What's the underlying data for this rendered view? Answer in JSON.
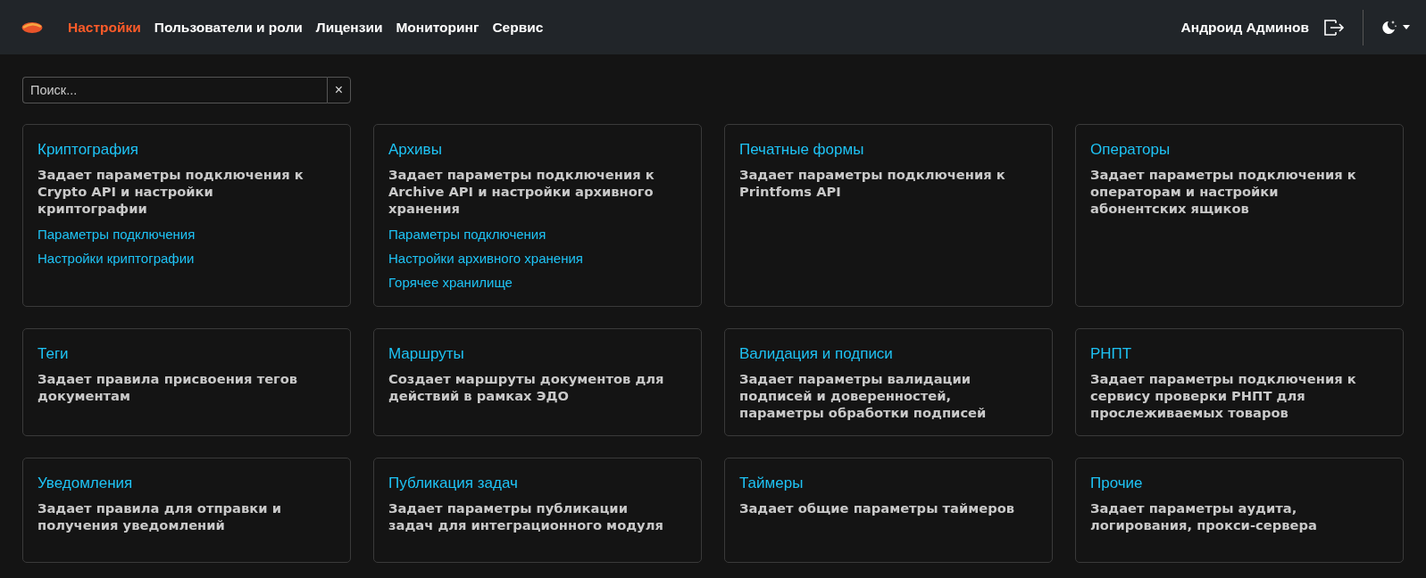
{
  "nav": {
    "items": [
      {
        "label": "Настройки",
        "selected": true
      },
      {
        "label": "Пользователи и роли",
        "selected": false
      },
      {
        "label": "Лицензии",
        "selected": false
      },
      {
        "label": "Мониторинг",
        "selected": false
      },
      {
        "label": "Сервис",
        "selected": false
      }
    ],
    "user": "Андроид Админов"
  },
  "theme": {
    "dark": true
  },
  "search": {
    "placeholder": "Поиск...",
    "clear": "×"
  },
  "cards": [
    {
      "title": "Криптография",
      "description": "Задает параметры подключения к Crypto API и настройки криптографии",
      "links": [
        "Параметры подключения",
        "Настройки криптографии"
      ]
    },
    {
      "title": "Архивы",
      "description": "Задает параметры подключения к Archive API и настройки архивного хранения",
      "links": [
        "Параметры подключения",
        "Настройки архивного хранения",
        "Горячее хранилище"
      ]
    },
    {
      "title": "Печатные формы",
      "description": "Задает параметры подключения к Printfoms API"
    },
    {
      "title": "Операторы",
      "description": "Задает параметры подключения к операторам и настройки абонентских ящиков"
    },
    {
      "title": "Теги",
      "description": "Задает правила присвоения тегов документам"
    },
    {
      "title": "Маршруты",
      "description": "Создает маршруты документов для действий в рамках ЭДО"
    },
    {
      "title": "Валидация и подписи",
      "description": "Задает параметры валидации подписей и доверенностей, параметры обработки подписей"
    },
    {
      "title": "РНПТ",
      "description": "Задает параметры подключения к сервису проверки РНПТ для прослеживаемых товаров"
    },
    {
      "title": "Уведомления",
      "description": "Задает правила для отправки и получения уведомлений"
    },
    {
      "title": "Публикация задач",
      "description": "Задает параметры публикации задач для интеграционного модуля"
    },
    {
      "title": "Таймеры",
      "description": "Задает общие параметры таймеров"
    },
    {
      "title": "Прочие",
      "description": "Задает параметры аудита, логирования, прокси-сервера"
    }
  ]
}
